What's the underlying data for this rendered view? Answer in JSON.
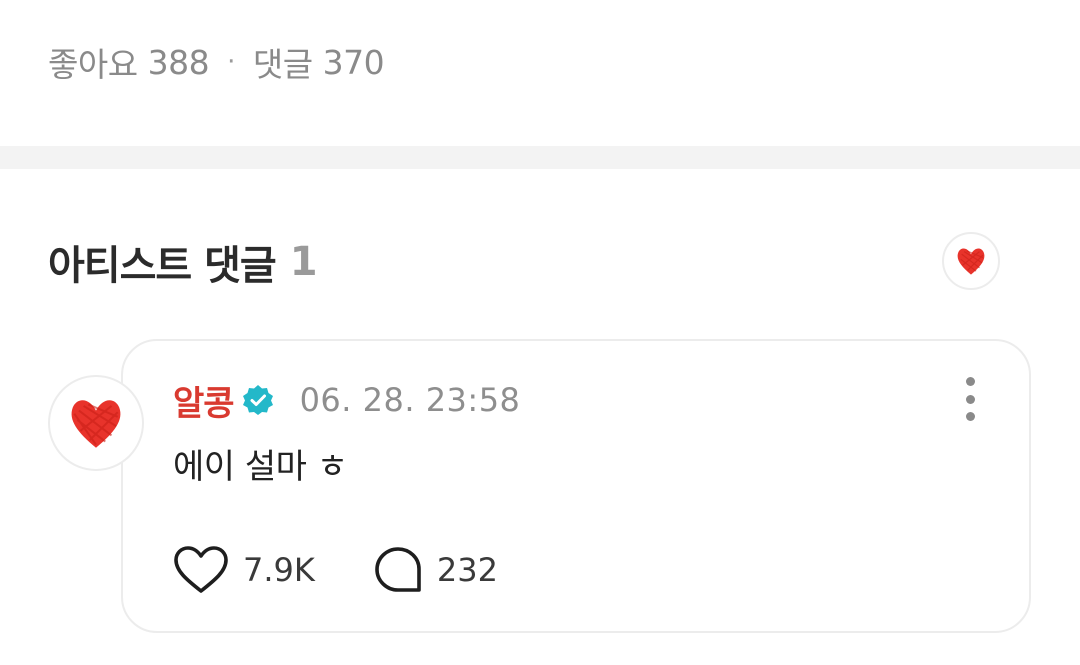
{
  "stats": {
    "likes_label": "좋아요",
    "likes_count": "388",
    "separator": "·",
    "comments_label": "댓글",
    "comments_count": "370"
  },
  "artist_comments": {
    "title": "아티스트 댓글",
    "count": "1",
    "filter_avatar_icon": "heart-scribble-icon"
  },
  "comment": {
    "author": "알콩",
    "verified_icon": "verified-badge-icon",
    "timestamp": "06. 28. 23:58",
    "text": "에이 설마 ㅎ",
    "likes": "7.9K",
    "replies": "232",
    "like_icon": "heart-outline-icon",
    "reply_icon": "speech-bubble-icon",
    "menu_icon": "more-vertical-icon"
  },
  "colors": {
    "author": "#d93a30",
    "verified": "#23b8c9",
    "heart": "#e8332b",
    "muted": "#8e8e8e",
    "divider": "#f3f3f3",
    "border": "#ececec"
  }
}
